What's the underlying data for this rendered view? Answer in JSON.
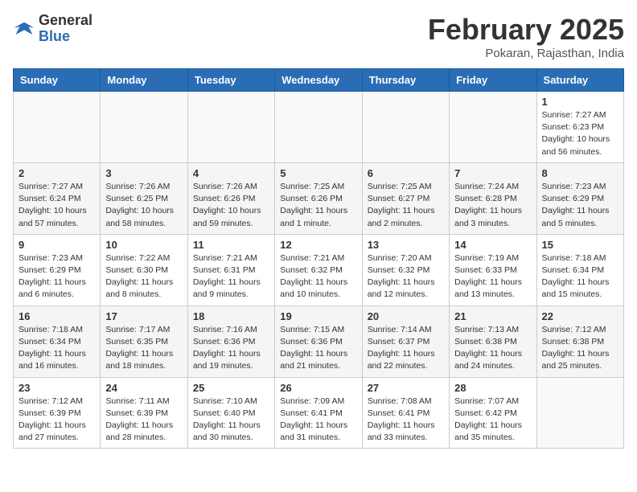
{
  "header": {
    "logo_general": "General",
    "logo_blue": "Blue",
    "month_title": "February 2025",
    "location": "Pokaran, Rajasthan, India"
  },
  "days_of_week": [
    "Sunday",
    "Monday",
    "Tuesday",
    "Wednesday",
    "Thursday",
    "Friday",
    "Saturday"
  ],
  "weeks": [
    [
      {
        "day": "",
        "info": ""
      },
      {
        "day": "",
        "info": ""
      },
      {
        "day": "",
        "info": ""
      },
      {
        "day": "",
        "info": ""
      },
      {
        "day": "",
        "info": ""
      },
      {
        "day": "",
        "info": ""
      },
      {
        "day": "1",
        "info": "Sunrise: 7:27 AM\nSunset: 6:23 PM\nDaylight: 10 hours\nand 56 minutes."
      }
    ],
    [
      {
        "day": "2",
        "info": "Sunrise: 7:27 AM\nSunset: 6:24 PM\nDaylight: 10 hours\nand 57 minutes."
      },
      {
        "day": "3",
        "info": "Sunrise: 7:26 AM\nSunset: 6:25 PM\nDaylight: 10 hours\nand 58 minutes."
      },
      {
        "day": "4",
        "info": "Sunrise: 7:26 AM\nSunset: 6:26 PM\nDaylight: 10 hours\nand 59 minutes."
      },
      {
        "day": "5",
        "info": "Sunrise: 7:25 AM\nSunset: 6:26 PM\nDaylight: 11 hours\nand 1 minute."
      },
      {
        "day": "6",
        "info": "Sunrise: 7:25 AM\nSunset: 6:27 PM\nDaylight: 11 hours\nand 2 minutes."
      },
      {
        "day": "7",
        "info": "Sunrise: 7:24 AM\nSunset: 6:28 PM\nDaylight: 11 hours\nand 3 minutes."
      },
      {
        "day": "8",
        "info": "Sunrise: 7:23 AM\nSunset: 6:29 PM\nDaylight: 11 hours\nand 5 minutes."
      }
    ],
    [
      {
        "day": "9",
        "info": "Sunrise: 7:23 AM\nSunset: 6:29 PM\nDaylight: 11 hours\nand 6 minutes."
      },
      {
        "day": "10",
        "info": "Sunrise: 7:22 AM\nSunset: 6:30 PM\nDaylight: 11 hours\nand 8 minutes."
      },
      {
        "day": "11",
        "info": "Sunrise: 7:21 AM\nSunset: 6:31 PM\nDaylight: 11 hours\nand 9 minutes."
      },
      {
        "day": "12",
        "info": "Sunrise: 7:21 AM\nSunset: 6:32 PM\nDaylight: 11 hours\nand 10 minutes."
      },
      {
        "day": "13",
        "info": "Sunrise: 7:20 AM\nSunset: 6:32 PM\nDaylight: 11 hours\nand 12 minutes."
      },
      {
        "day": "14",
        "info": "Sunrise: 7:19 AM\nSunset: 6:33 PM\nDaylight: 11 hours\nand 13 minutes."
      },
      {
        "day": "15",
        "info": "Sunrise: 7:18 AM\nSunset: 6:34 PM\nDaylight: 11 hours\nand 15 minutes."
      }
    ],
    [
      {
        "day": "16",
        "info": "Sunrise: 7:18 AM\nSunset: 6:34 PM\nDaylight: 11 hours\nand 16 minutes."
      },
      {
        "day": "17",
        "info": "Sunrise: 7:17 AM\nSunset: 6:35 PM\nDaylight: 11 hours\nand 18 minutes."
      },
      {
        "day": "18",
        "info": "Sunrise: 7:16 AM\nSunset: 6:36 PM\nDaylight: 11 hours\nand 19 minutes."
      },
      {
        "day": "19",
        "info": "Sunrise: 7:15 AM\nSunset: 6:36 PM\nDaylight: 11 hours\nand 21 minutes."
      },
      {
        "day": "20",
        "info": "Sunrise: 7:14 AM\nSunset: 6:37 PM\nDaylight: 11 hours\nand 22 minutes."
      },
      {
        "day": "21",
        "info": "Sunrise: 7:13 AM\nSunset: 6:38 PM\nDaylight: 11 hours\nand 24 minutes."
      },
      {
        "day": "22",
        "info": "Sunrise: 7:12 AM\nSunset: 6:38 PM\nDaylight: 11 hours\nand 25 minutes."
      }
    ],
    [
      {
        "day": "23",
        "info": "Sunrise: 7:12 AM\nSunset: 6:39 PM\nDaylight: 11 hours\nand 27 minutes."
      },
      {
        "day": "24",
        "info": "Sunrise: 7:11 AM\nSunset: 6:39 PM\nDaylight: 11 hours\nand 28 minutes."
      },
      {
        "day": "25",
        "info": "Sunrise: 7:10 AM\nSunset: 6:40 PM\nDaylight: 11 hours\nand 30 minutes."
      },
      {
        "day": "26",
        "info": "Sunrise: 7:09 AM\nSunset: 6:41 PM\nDaylight: 11 hours\nand 31 minutes."
      },
      {
        "day": "27",
        "info": "Sunrise: 7:08 AM\nSunset: 6:41 PM\nDaylight: 11 hours\nand 33 minutes."
      },
      {
        "day": "28",
        "info": "Sunrise: 7:07 AM\nSunset: 6:42 PM\nDaylight: 11 hours\nand 35 minutes."
      },
      {
        "day": "",
        "info": ""
      }
    ]
  ]
}
